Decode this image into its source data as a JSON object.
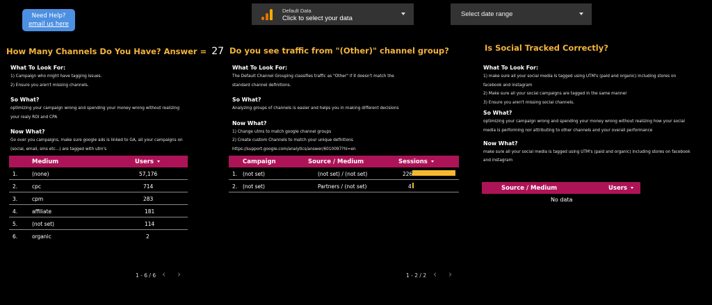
{
  "help": {
    "line1": "Need Help?",
    "line2": "email us here"
  },
  "data_control": {
    "label": "Default Data",
    "value": "Click to select your data",
    "icon": "google-analytics-icon"
  },
  "date_control": {
    "value": "Select date range"
  },
  "panel1": {
    "title": "How Many Channels Do You Have? Answer  =",
    "answer": "27",
    "look_heading": "What To Look For:",
    "look_lines": [
      "1) Campaign who might have tagging issues.",
      "2) Ensure you aren't missing channels."
    ],
    "sowhat_heading": "So What?",
    "sowhat_lines": [
      "optimizing your campaign wrong and spending your money wrong without realizing",
      "your realy ROI and CPA"
    ],
    "nowwhat_heading": "Now What?",
    "nowwhat_lines": [
      "Go over you campaigns, make sure google ads is linked to GA, all your campaigns on",
      "(social, email, sms etc...) are tagged with utm's"
    ],
    "table": {
      "headers": [
        "Medium",
        "Users"
      ],
      "rows": [
        [
          "1.",
          "(none)",
          "57,176"
        ],
        [
          "2.",
          "cpc",
          "714"
        ],
        [
          "3.",
          "cpm",
          "283"
        ],
        [
          "4.",
          "affiliate",
          "181"
        ],
        [
          "5.",
          "(not set)",
          "114"
        ],
        [
          "6.",
          "organic",
          "2"
        ]
      ],
      "pager": "1 - 6 / 6"
    }
  },
  "panel2": {
    "title": "Do you see traffic from \"(Other)\" channel group?",
    "look_heading": "What To Look For:",
    "look_lines": [
      "The Default Channel Grouping classifies traffic as \"Other\" if it doesn't match the",
      "standard channel definitions."
    ],
    "sowhat_heading": "So What?",
    "sowhat_lines": [
      "Analyzing groups of channels is easier and helps you in making different decisions"
    ],
    "nowwhat_heading": "Now What?",
    "nowwhat_lines": [
      "1) Change utms to match google channel groups",
      "2) Create custom Channels to match your unique defintions",
      "https://support.google.com/analytics/answer/6010097?hl=en"
    ],
    "table": {
      "headers": [
        "Campaign",
        "Source / Medium",
        "Sessions"
      ],
      "rows": [
        [
          "1.",
          "(not set)",
          "(not set) / (not set)",
          "226"
        ],
        [
          "2.",
          "(not set)",
          "Partners / (not set)",
          "4"
        ]
      ],
      "bar_fraction": [
        1.0,
        0.018
      ],
      "pager": "1 - 2 / 2"
    }
  },
  "panel3": {
    "title": "Is Social Tracked Correctly?",
    "look_heading": "What To Look For:",
    "look_lines": [
      "1) make sure all your social media is tagged using UTM's (paid and organic) including stores on",
      "facebook and instagram",
      "2) Make sure all your social campaigns are tagged in the same manner",
      "3) Ensure you aren't missing social channels."
    ],
    "sowhat_heading": "So What?",
    "sowhat_lines": [
      "optimizing your campaign wrong and spending your money wrong without realizing how your social",
      "media is performing nor attributing to other channels and your overall performance"
    ],
    "nowwhat_heading": "Now What?",
    "nowwhat_lines": [
      "make sure all your social media is tagged using UTM's (paid and organic) including stores on facebook",
      "and instagram"
    ],
    "table": {
      "headers": [
        "Source / Medium",
        "Users"
      ],
      "empty": "No data"
    }
  },
  "colors": {
    "accent_title": "#f4b43c",
    "table_header": "#ad1457",
    "bar": "#f5b82e",
    "help_button": "#4d8fe0"
  }
}
